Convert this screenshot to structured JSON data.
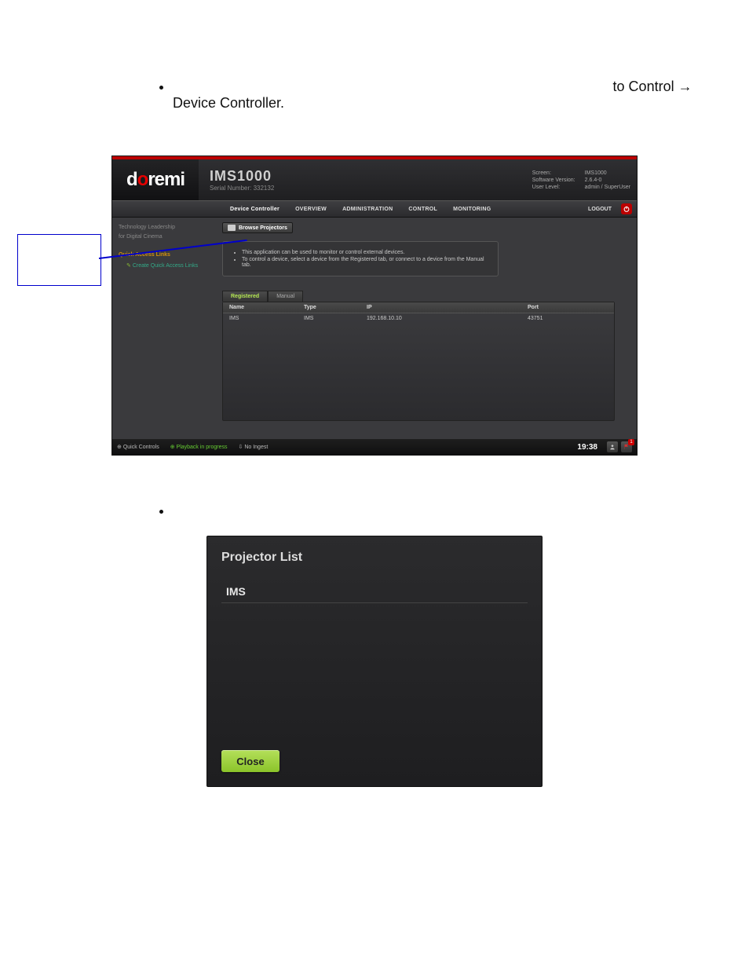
{
  "doc": {
    "bullet1_tail": "to Control → Device Controller."
  },
  "shot1": {
    "logo_pre": "d",
    "logo_o": "o",
    "logo_post": "remi",
    "title": "IMS1000",
    "serial_label": "Serial Number: 332132",
    "hdr_labels": {
      "screen": "Screen:",
      "sw": "Software Version:",
      "user": "User Level:"
    },
    "hdr_vals": {
      "screen": "IMS1000",
      "sw": "2.6.4-0",
      "user": "admin / SuperUser"
    },
    "nav": [
      "Device Controller",
      "OVERVIEW",
      "ADMINISTRATION",
      "CONTROL",
      "MONITORING"
    ],
    "logout": "LOGOUT",
    "side_h1": "Technology Leadership",
    "side_h2": "for Digital Cinema",
    "qal": "Quick Access Links",
    "qal_item": "Create Quick Access Links",
    "browse": "Browse Projectors",
    "info1": "This application can be used to monitor or control external devices.",
    "info2": "To control a device, select a device from the Registered tab, or connect to a device from the Manual tab.",
    "tabs": [
      "Registered",
      "Manual"
    ],
    "thead": {
      "name": "Name",
      "type": "Type",
      "ip": "IP",
      "port": "Port"
    },
    "row": {
      "name": "IMS",
      "type": "IMS",
      "ip": "192.168.10.10",
      "port": "43751"
    },
    "status": {
      "quick": "Quick Controls",
      "play": "Playback in progress",
      "ingest": "No Ingest",
      "clock": "19:38",
      "flag_badge": "1"
    }
  },
  "shot2": {
    "title": "Projector List",
    "item": "IMS",
    "close": "Close"
  }
}
